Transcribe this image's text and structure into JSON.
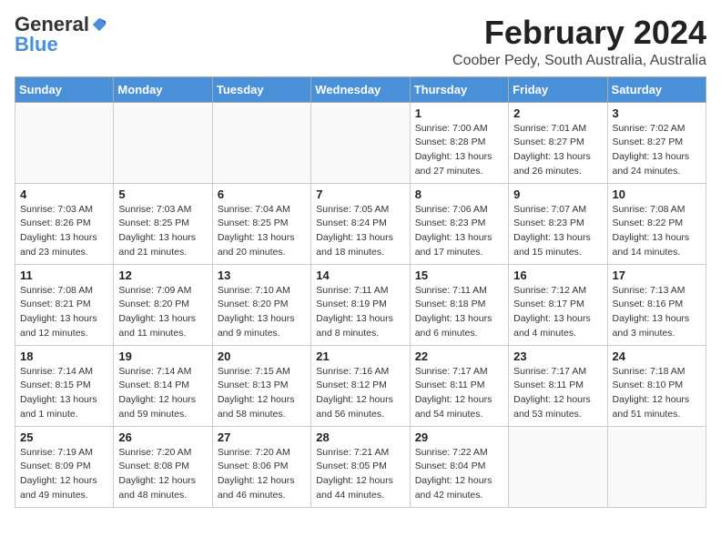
{
  "header": {
    "logo_general": "General",
    "logo_blue": "Blue",
    "month_year": "February 2024",
    "location": "Coober Pedy, South Australia, Australia"
  },
  "weekdays": [
    "Sunday",
    "Monday",
    "Tuesday",
    "Wednesday",
    "Thursday",
    "Friday",
    "Saturday"
  ],
  "weeks": [
    [
      {
        "day": "",
        "info": ""
      },
      {
        "day": "",
        "info": ""
      },
      {
        "day": "",
        "info": ""
      },
      {
        "day": "",
        "info": ""
      },
      {
        "day": "1",
        "info": "Sunrise: 7:00 AM\nSunset: 8:28 PM\nDaylight: 13 hours\nand 27 minutes."
      },
      {
        "day": "2",
        "info": "Sunrise: 7:01 AM\nSunset: 8:27 PM\nDaylight: 13 hours\nand 26 minutes."
      },
      {
        "day": "3",
        "info": "Sunrise: 7:02 AM\nSunset: 8:27 PM\nDaylight: 13 hours\nand 24 minutes."
      }
    ],
    [
      {
        "day": "4",
        "info": "Sunrise: 7:03 AM\nSunset: 8:26 PM\nDaylight: 13 hours\nand 23 minutes."
      },
      {
        "day": "5",
        "info": "Sunrise: 7:03 AM\nSunset: 8:25 PM\nDaylight: 13 hours\nand 21 minutes."
      },
      {
        "day": "6",
        "info": "Sunrise: 7:04 AM\nSunset: 8:25 PM\nDaylight: 13 hours\nand 20 minutes."
      },
      {
        "day": "7",
        "info": "Sunrise: 7:05 AM\nSunset: 8:24 PM\nDaylight: 13 hours\nand 18 minutes."
      },
      {
        "day": "8",
        "info": "Sunrise: 7:06 AM\nSunset: 8:23 PM\nDaylight: 13 hours\nand 17 minutes."
      },
      {
        "day": "9",
        "info": "Sunrise: 7:07 AM\nSunset: 8:23 PM\nDaylight: 13 hours\nand 15 minutes."
      },
      {
        "day": "10",
        "info": "Sunrise: 7:08 AM\nSunset: 8:22 PM\nDaylight: 13 hours\nand 14 minutes."
      }
    ],
    [
      {
        "day": "11",
        "info": "Sunrise: 7:08 AM\nSunset: 8:21 PM\nDaylight: 13 hours\nand 12 minutes."
      },
      {
        "day": "12",
        "info": "Sunrise: 7:09 AM\nSunset: 8:20 PM\nDaylight: 13 hours\nand 11 minutes."
      },
      {
        "day": "13",
        "info": "Sunrise: 7:10 AM\nSunset: 8:20 PM\nDaylight: 13 hours\nand 9 minutes."
      },
      {
        "day": "14",
        "info": "Sunrise: 7:11 AM\nSunset: 8:19 PM\nDaylight: 13 hours\nand 8 minutes."
      },
      {
        "day": "15",
        "info": "Sunrise: 7:11 AM\nSunset: 8:18 PM\nDaylight: 13 hours\nand 6 minutes."
      },
      {
        "day": "16",
        "info": "Sunrise: 7:12 AM\nSunset: 8:17 PM\nDaylight: 13 hours\nand 4 minutes."
      },
      {
        "day": "17",
        "info": "Sunrise: 7:13 AM\nSunset: 8:16 PM\nDaylight: 13 hours\nand 3 minutes."
      }
    ],
    [
      {
        "day": "18",
        "info": "Sunrise: 7:14 AM\nSunset: 8:15 PM\nDaylight: 13 hours\nand 1 minute."
      },
      {
        "day": "19",
        "info": "Sunrise: 7:14 AM\nSunset: 8:14 PM\nDaylight: 12 hours\nand 59 minutes."
      },
      {
        "day": "20",
        "info": "Sunrise: 7:15 AM\nSunset: 8:13 PM\nDaylight: 12 hours\nand 58 minutes."
      },
      {
        "day": "21",
        "info": "Sunrise: 7:16 AM\nSunset: 8:12 PM\nDaylight: 12 hours\nand 56 minutes."
      },
      {
        "day": "22",
        "info": "Sunrise: 7:17 AM\nSunset: 8:11 PM\nDaylight: 12 hours\nand 54 minutes."
      },
      {
        "day": "23",
        "info": "Sunrise: 7:17 AM\nSunset: 8:11 PM\nDaylight: 12 hours\nand 53 minutes."
      },
      {
        "day": "24",
        "info": "Sunrise: 7:18 AM\nSunset: 8:10 PM\nDaylight: 12 hours\nand 51 minutes."
      }
    ],
    [
      {
        "day": "25",
        "info": "Sunrise: 7:19 AM\nSunset: 8:09 PM\nDaylight: 12 hours\nand 49 minutes."
      },
      {
        "day": "26",
        "info": "Sunrise: 7:20 AM\nSunset: 8:08 PM\nDaylight: 12 hours\nand 48 minutes."
      },
      {
        "day": "27",
        "info": "Sunrise: 7:20 AM\nSunset: 8:06 PM\nDaylight: 12 hours\nand 46 minutes."
      },
      {
        "day": "28",
        "info": "Sunrise: 7:21 AM\nSunset: 8:05 PM\nDaylight: 12 hours\nand 44 minutes."
      },
      {
        "day": "29",
        "info": "Sunrise: 7:22 AM\nSunset: 8:04 PM\nDaylight: 12 hours\nand 42 minutes."
      },
      {
        "day": "",
        "info": ""
      },
      {
        "day": "",
        "info": ""
      }
    ]
  ]
}
